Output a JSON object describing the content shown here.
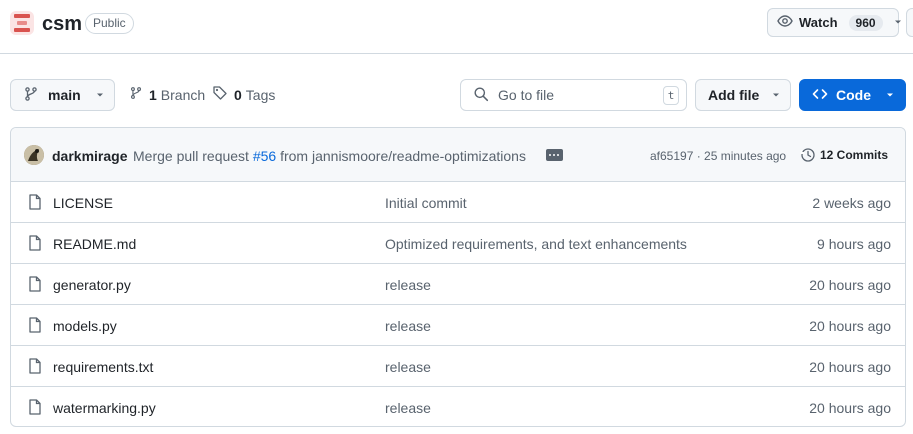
{
  "repo": {
    "name": "csm",
    "visibility": "Public"
  },
  "watch": {
    "label": "Watch",
    "count": "960"
  },
  "toolbar": {
    "branch": "main",
    "branches_count": "1",
    "branches_label": "Branch",
    "tags_count": "0",
    "tags_label": "Tags",
    "search_placeholder": "Go to file",
    "search_shortcut": "t",
    "add_file_label": "Add file",
    "code_label": "Code"
  },
  "commit": {
    "author": "darkmirage",
    "message_prefix": "Merge pull request ",
    "pr_link": "#56",
    "message_suffix": " from jannismoore/readme-optimizations",
    "hash_time": "af65197 · 25 minutes ago",
    "commits_label": "12 Commits"
  },
  "files": [
    {
      "name": "LICENSE",
      "message": "Initial commit",
      "time": "2 weeks ago"
    },
    {
      "name": "README.md",
      "message": "Optimized requirements, and text enhancements",
      "time": "9 hours ago"
    },
    {
      "name": "generator.py",
      "message": "release",
      "time": "20 hours ago"
    },
    {
      "name": "models.py",
      "message": "release",
      "time": "20 hours ago"
    },
    {
      "name": "requirements.txt",
      "message": "release",
      "time": "20 hours ago"
    },
    {
      "name": "watermarking.py",
      "message": "release",
      "time": "20 hours ago"
    }
  ],
  "colors": {
    "accent": "#0969da",
    "border": "#d1d9e0",
    "muted": "#59636e",
    "logo": "#d9534f"
  }
}
